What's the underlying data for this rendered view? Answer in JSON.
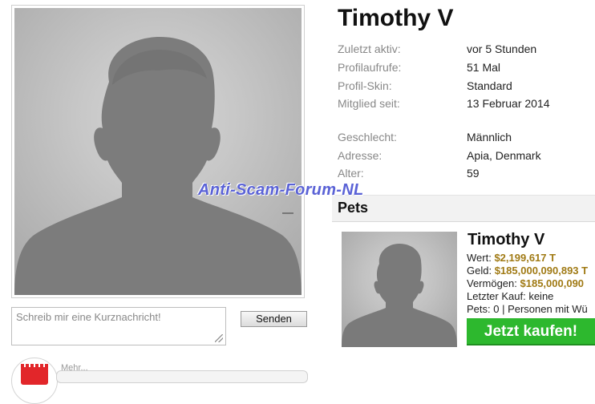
{
  "profile": {
    "name": "Timothy V",
    "info": [
      {
        "label": "Zuletzt aktiv:",
        "value": "vor 5 Stunden"
      },
      {
        "label": "Profilaufrufe:",
        "value": "51 Mal"
      },
      {
        "label": "Profil-Skin:",
        "value": "Standard"
      },
      {
        "label": "Mitglied seit:",
        "value": "13 Februar 2014"
      },
      {
        "label": "Geschlecht:",
        "value": "Männlich"
      },
      {
        "label": "Adresse:",
        "value": "Apia, Denmark"
      },
      {
        "label": "Alter:",
        "value": "59"
      }
    ]
  },
  "message": {
    "placeholder": "Schreib mir eine Kurznachricht!",
    "send_label": "Senden"
  },
  "bottom": {
    "label": "Mehr..."
  },
  "watermark": "Anti-Scam-Forum-NL",
  "pets": {
    "title": "Pets",
    "pet_name": "Timothy V",
    "wert_label": "Wert:",
    "wert_value": "$2,199,617 T",
    "geld_label": "Geld:",
    "geld_value": "$185,000,090,893 T",
    "vermoegen_label": "Vermögen:",
    "vermoegen_value": "$185,000,090",
    "letzter_kauf": "Letzter Kauf: keine",
    "pets_line": "Pets: 0 | Personen mit Wü",
    "buy_label": "Jetzt kaufen!"
  },
  "colors": {
    "gold": "#a07a14",
    "buy_green": "#2db82e",
    "watermark": "#5a62d6"
  }
}
